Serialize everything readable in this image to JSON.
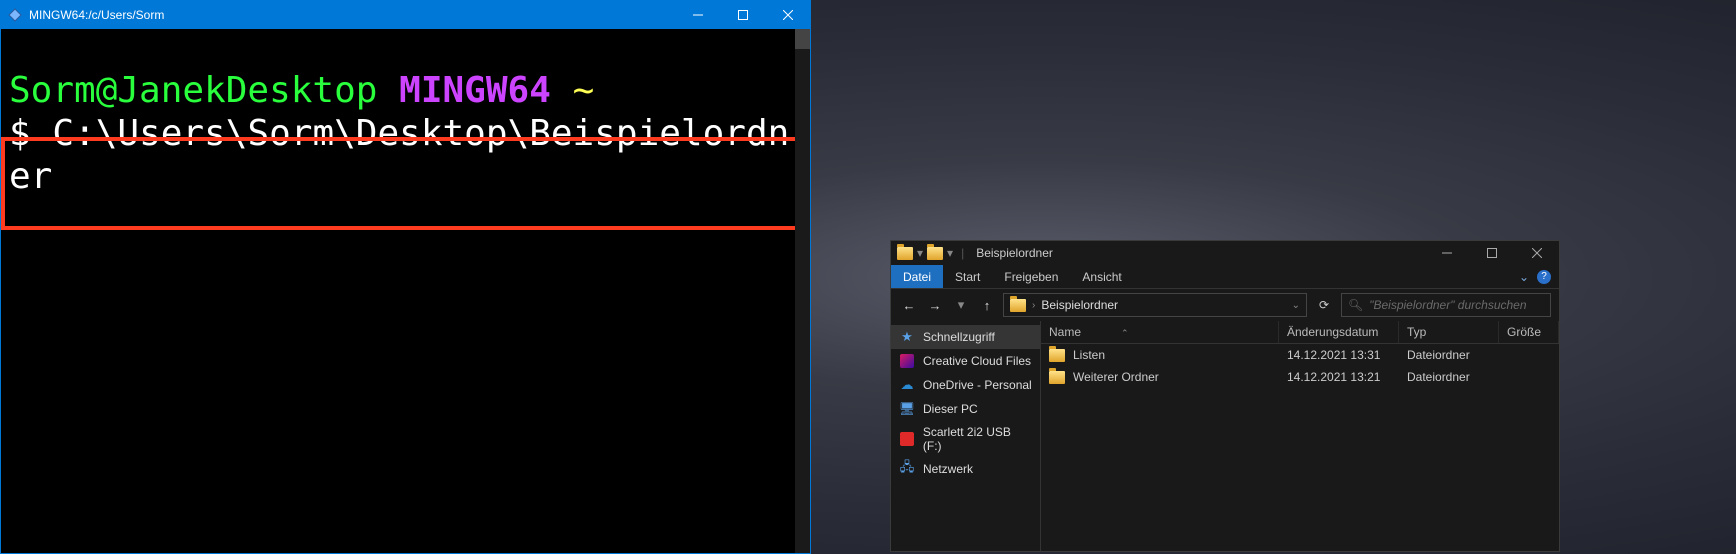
{
  "terminal": {
    "title": "MINGW64:/c/Users/Sorm",
    "prompt_user": "Sorm@JanekDesktop",
    "prompt_env": "MINGW64",
    "prompt_path": "~",
    "dollar": "$",
    "command": "C:\\Users\\Sorm\\Desktop\\Beispielordner"
  },
  "explorer": {
    "title": "Beispielordner",
    "tabs": {
      "datei": "Datei",
      "start": "Start",
      "freigeben": "Freigeben",
      "ansicht": "Ansicht"
    },
    "addressbar": {
      "crumb": "Beispielordner"
    },
    "search_placeholder": "\"Beispielordner\" durchsuchen",
    "nav": {
      "schnellzugriff": "Schnellzugriff",
      "creative_cloud": "Creative Cloud Files",
      "onedrive": "OneDrive - Personal",
      "dieser_pc": "Dieser PC",
      "scarlett": "Scarlett 2i2 USB (F:)",
      "netzwerk": "Netzwerk"
    },
    "columns": {
      "name": "Name",
      "date": "Änderungsdatum",
      "type": "Typ",
      "size": "Größe"
    },
    "rows": [
      {
        "name": "Listen",
        "date": "14.12.2021 13:31",
        "type": "Dateiordner",
        "size": ""
      },
      {
        "name": "Weiterer Ordner",
        "date": "14.12.2021 13:21",
        "type": "Dateiordner",
        "size": ""
      }
    ]
  }
}
